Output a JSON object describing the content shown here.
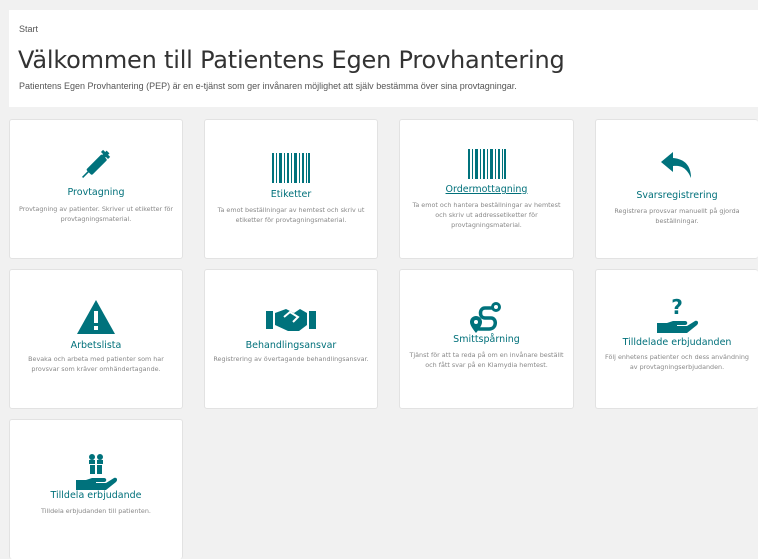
{
  "header": {
    "breadcrumb": "Start",
    "title": "Välkommen till Patientens Egen Provhantering",
    "subtitle": "Patientens Egen Provhantering (PEP) är en e-tjänst som ger invånaren möjlighet att själv bestämma över sina provtagningar."
  },
  "colors": {
    "accent": "#00707a",
    "icon": "#00727c",
    "background": "#f1f1f1"
  },
  "cards": [
    {
      "title": "Provtagning",
      "description": "Provtagning av patienter. Skriver ut etiketter för provtagningsmaterial.",
      "icon": "syringe-icon"
    },
    {
      "title": "Etiketter",
      "description": "Ta emot beställningar av hemtest och skriv ut etiketter för provtagningsmaterial.",
      "icon": "barcode-icon"
    },
    {
      "title": "Ordermottagning",
      "description": "Ta emot och hantera beställningar av hemtest och skriv ut addressetiketter för provtagningsmaterial.",
      "icon": "barcode-icon"
    },
    {
      "title": "Svarsregistrering",
      "description": "Registrera provsvar manuellt på gjorda beställningar.",
      "icon": "reply-arrow-icon"
    },
    {
      "title": "Arbetslista",
      "description": "Bevaka och arbeta med patienter som har provsvar som kräver omhändertagande.",
      "icon": "warning-icon"
    },
    {
      "title": "Behandlingsansvar",
      "description": "Registrering av övertagande behandlingsansvar.",
      "icon": "handshake-icon"
    },
    {
      "title": "Smittspårning",
      "description": "Tjänst för att ta reda på om en invånare beställt och fått svar på en Klamydia hemtest.",
      "icon": "route-icon"
    },
    {
      "title": "Tilldelade erbjudanden",
      "description": "Följ enhetens patienter och dess användning av provtagningserbjudanden.",
      "icon": "hand-question-icon"
    },
    {
      "title": "Tilldela erbjudande",
      "description": "Tilldela erbjudanden till patienten.",
      "icon": "hand-gift-icon"
    }
  ]
}
